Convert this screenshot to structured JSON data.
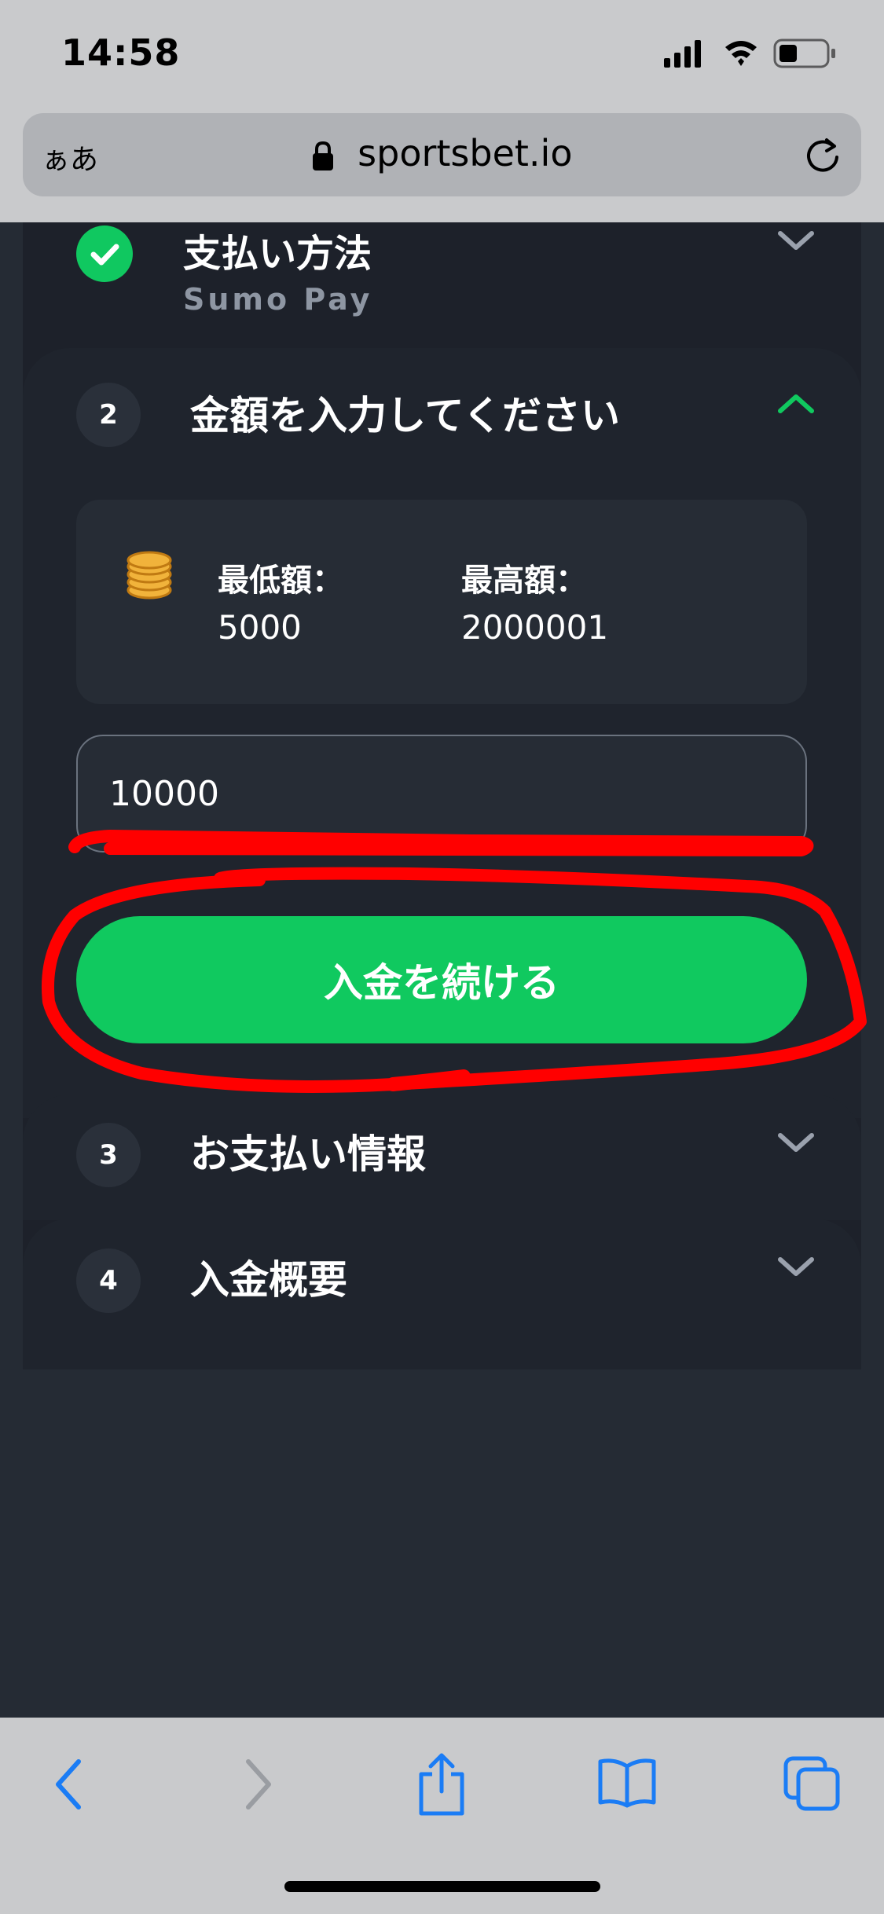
{
  "status_bar": {
    "time": "14:58"
  },
  "browser": {
    "aa_label": "ぁあ",
    "url": "sportsbet.io"
  },
  "deposit": {
    "step1": {
      "title": "支払い方法",
      "subtitle": "Sumo Pay"
    },
    "step2": {
      "number": "2",
      "title": "金額を入力してください",
      "min_label": "最低額：",
      "min_value": "5000",
      "max_label": "最高額：",
      "max_value": "2000001",
      "amount_value": "10000",
      "continue_label": "入金を続ける"
    },
    "step3": {
      "number": "3",
      "title": "お支払い情報"
    },
    "step4": {
      "number": "4",
      "title": "入金概要"
    }
  },
  "colors": {
    "accent": "#10c95f",
    "background": "#252b34",
    "panel": "#1d212a",
    "annotation": "#ff0000"
  },
  "icons": [
    "signal-icon",
    "wifi-icon",
    "battery-icon",
    "lock-icon",
    "reload-icon",
    "check-icon",
    "chevron-down-icon",
    "chevron-up-icon",
    "coins-icon",
    "back-icon",
    "forward-icon",
    "share-icon",
    "bookmarks-icon",
    "tabs-icon"
  ]
}
